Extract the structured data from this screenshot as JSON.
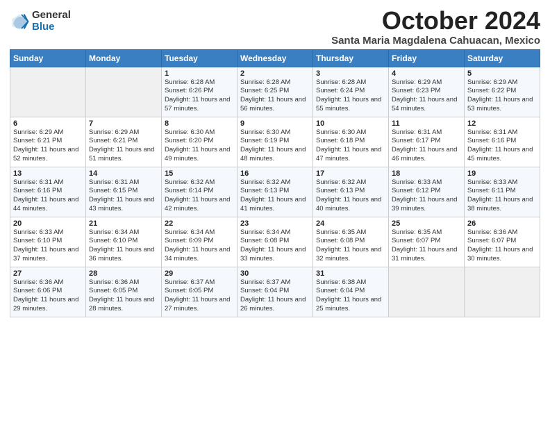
{
  "header": {
    "logo_general": "General",
    "logo_blue": "Blue",
    "month_title": "October 2024",
    "location": "Santa Maria Magdalena Cahuacan, Mexico"
  },
  "days_of_week": [
    "Sunday",
    "Monday",
    "Tuesday",
    "Wednesday",
    "Thursday",
    "Friday",
    "Saturday"
  ],
  "weeks": [
    [
      {
        "day": "",
        "sunrise": "",
        "sunset": "",
        "daylight": ""
      },
      {
        "day": "",
        "sunrise": "",
        "sunset": "",
        "daylight": ""
      },
      {
        "day": "1",
        "sunrise": "Sunrise: 6:28 AM",
        "sunset": "Sunset: 6:26 PM",
        "daylight": "Daylight: 11 hours and 57 minutes."
      },
      {
        "day": "2",
        "sunrise": "Sunrise: 6:28 AM",
        "sunset": "Sunset: 6:25 PM",
        "daylight": "Daylight: 11 hours and 56 minutes."
      },
      {
        "day": "3",
        "sunrise": "Sunrise: 6:28 AM",
        "sunset": "Sunset: 6:24 PM",
        "daylight": "Daylight: 11 hours and 55 minutes."
      },
      {
        "day": "4",
        "sunrise": "Sunrise: 6:29 AM",
        "sunset": "Sunset: 6:23 PM",
        "daylight": "Daylight: 11 hours and 54 minutes."
      },
      {
        "day": "5",
        "sunrise": "Sunrise: 6:29 AM",
        "sunset": "Sunset: 6:22 PM",
        "daylight": "Daylight: 11 hours and 53 minutes."
      }
    ],
    [
      {
        "day": "6",
        "sunrise": "Sunrise: 6:29 AM",
        "sunset": "Sunset: 6:21 PM",
        "daylight": "Daylight: 11 hours and 52 minutes."
      },
      {
        "day": "7",
        "sunrise": "Sunrise: 6:29 AM",
        "sunset": "Sunset: 6:21 PM",
        "daylight": "Daylight: 11 hours and 51 minutes."
      },
      {
        "day": "8",
        "sunrise": "Sunrise: 6:30 AM",
        "sunset": "Sunset: 6:20 PM",
        "daylight": "Daylight: 11 hours and 49 minutes."
      },
      {
        "day": "9",
        "sunrise": "Sunrise: 6:30 AM",
        "sunset": "Sunset: 6:19 PM",
        "daylight": "Daylight: 11 hours and 48 minutes."
      },
      {
        "day": "10",
        "sunrise": "Sunrise: 6:30 AM",
        "sunset": "Sunset: 6:18 PM",
        "daylight": "Daylight: 11 hours and 47 minutes."
      },
      {
        "day": "11",
        "sunrise": "Sunrise: 6:31 AM",
        "sunset": "Sunset: 6:17 PM",
        "daylight": "Daylight: 11 hours and 46 minutes."
      },
      {
        "day": "12",
        "sunrise": "Sunrise: 6:31 AM",
        "sunset": "Sunset: 6:16 PM",
        "daylight": "Daylight: 11 hours and 45 minutes."
      }
    ],
    [
      {
        "day": "13",
        "sunrise": "Sunrise: 6:31 AM",
        "sunset": "Sunset: 6:16 PM",
        "daylight": "Daylight: 11 hours and 44 minutes."
      },
      {
        "day": "14",
        "sunrise": "Sunrise: 6:31 AM",
        "sunset": "Sunset: 6:15 PM",
        "daylight": "Daylight: 11 hours and 43 minutes."
      },
      {
        "day": "15",
        "sunrise": "Sunrise: 6:32 AM",
        "sunset": "Sunset: 6:14 PM",
        "daylight": "Daylight: 11 hours and 42 minutes."
      },
      {
        "day": "16",
        "sunrise": "Sunrise: 6:32 AM",
        "sunset": "Sunset: 6:13 PM",
        "daylight": "Daylight: 11 hours and 41 minutes."
      },
      {
        "day": "17",
        "sunrise": "Sunrise: 6:32 AM",
        "sunset": "Sunset: 6:13 PM",
        "daylight": "Daylight: 11 hours and 40 minutes."
      },
      {
        "day": "18",
        "sunrise": "Sunrise: 6:33 AM",
        "sunset": "Sunset: 6:12 PM",
        "daylight": "Daylight: 11 hours and 39 minutes."
      },
      {
        "day": "19",
        "sunrise": "Sunrise: 6:33 AM",
        "sunset": "Sunset: 6:11 PM",
        "daylight": "Daylight: 11 hours and 38 minutes."
      }
    ],
    [
      {
        "day": "20",
        "sunrise": "Sunrise: 6:33 AM",
        "sunset": "Sunset: 6:10 PM",
        "daylight": "Daylight: 11 hours and 37 minutes."
      },
      {
        "day": "21",
        "sunrise": "Sunrise: 6:34 AM",
        "sunset": "Sunset: 6:10 PM",
        "daylight": "Daylight: 11 hours and 36 minutes."
      },
      {
        "day": "22",
        "sunrise": "Sunrise: 6:34 AM",
        "sunset": "Sunset: 6:09 PM",
        "daylight": "Daylight: 11 hours and 34 minutes."
      },
      {
        "day": "23",
        "sunrise": "Sunrise: 6:34 AM",
        "sunset": "Sunset: 6:08 PM",
        "daylight": "Daylight: 11 hours and 33 minutes."
      },
      {
        "day": "24",
        "sunrise": "Sunrise: 6:35 AM",
        "sunset": "Sunset: 6:08 PM",
        "daylight": "Daylight: 11 hours and 32 minutes."
      },
      {
        "day": "25",
        "sunrise": "Sunrise: 6:35 AM",
        "sunset": "Sunset: 6:07 PM",
        "daylight": "Daylight: 11 hours and 31 minutes."
      },
      {
        "day": "26",
        "sunrise": "Sunrise: 6:36 AM",
        "sunset": "Sunset: 6:07 PM",
        "daylight": "Daylight: 11 hours and 30 minutes."
      }
    ],
    [
      {
        "day": "27",
        "sunrise": "Sunrise: 6:36 AM",
        "sunset": "Sunset: 6:06 PM",
        "daylight": "Daylight: 11 hours and 29 minutes."
      },
      {
        "day": "28",
        "sunrise": "Sunrise: 6:36 AM",
        "sunset": "Sunset: 6:05 PM",
        "daylight": "Daylight: 11 hours and 28 minutes."
      },
      {
        "day": "29",
        "sunrise": "Sunrise: 6:37 AM",
        "sunset": "Sunset: 6:05 PM",
        "daylight": "Daylight: 11 hours and 27 minutes."
      },
      {
        "day": "30",
        "sunrise": "Sunrise: 6:37 AM",
        "sunset": "Sunset: 6:04 PM",
        "daylight": "Daylight: 11 hours and 26 minutes."
      },
      {
        "day": "31",
        "sunrise": "Sunrise: 6:38 AM",
        "sunset": "Sunset: 6:04 PM",
        "daylight": "Daylight: 11 hours and 25 minutes."
      },
      {
        "day": "",
        "sunrise": "",
        "sunset": "",
        "daylight": ""
      },
      {
        "day": "",
        "sunrise": "",
        "sunset": "",
        "daylight": ""
      }
    ]
  ]
}
